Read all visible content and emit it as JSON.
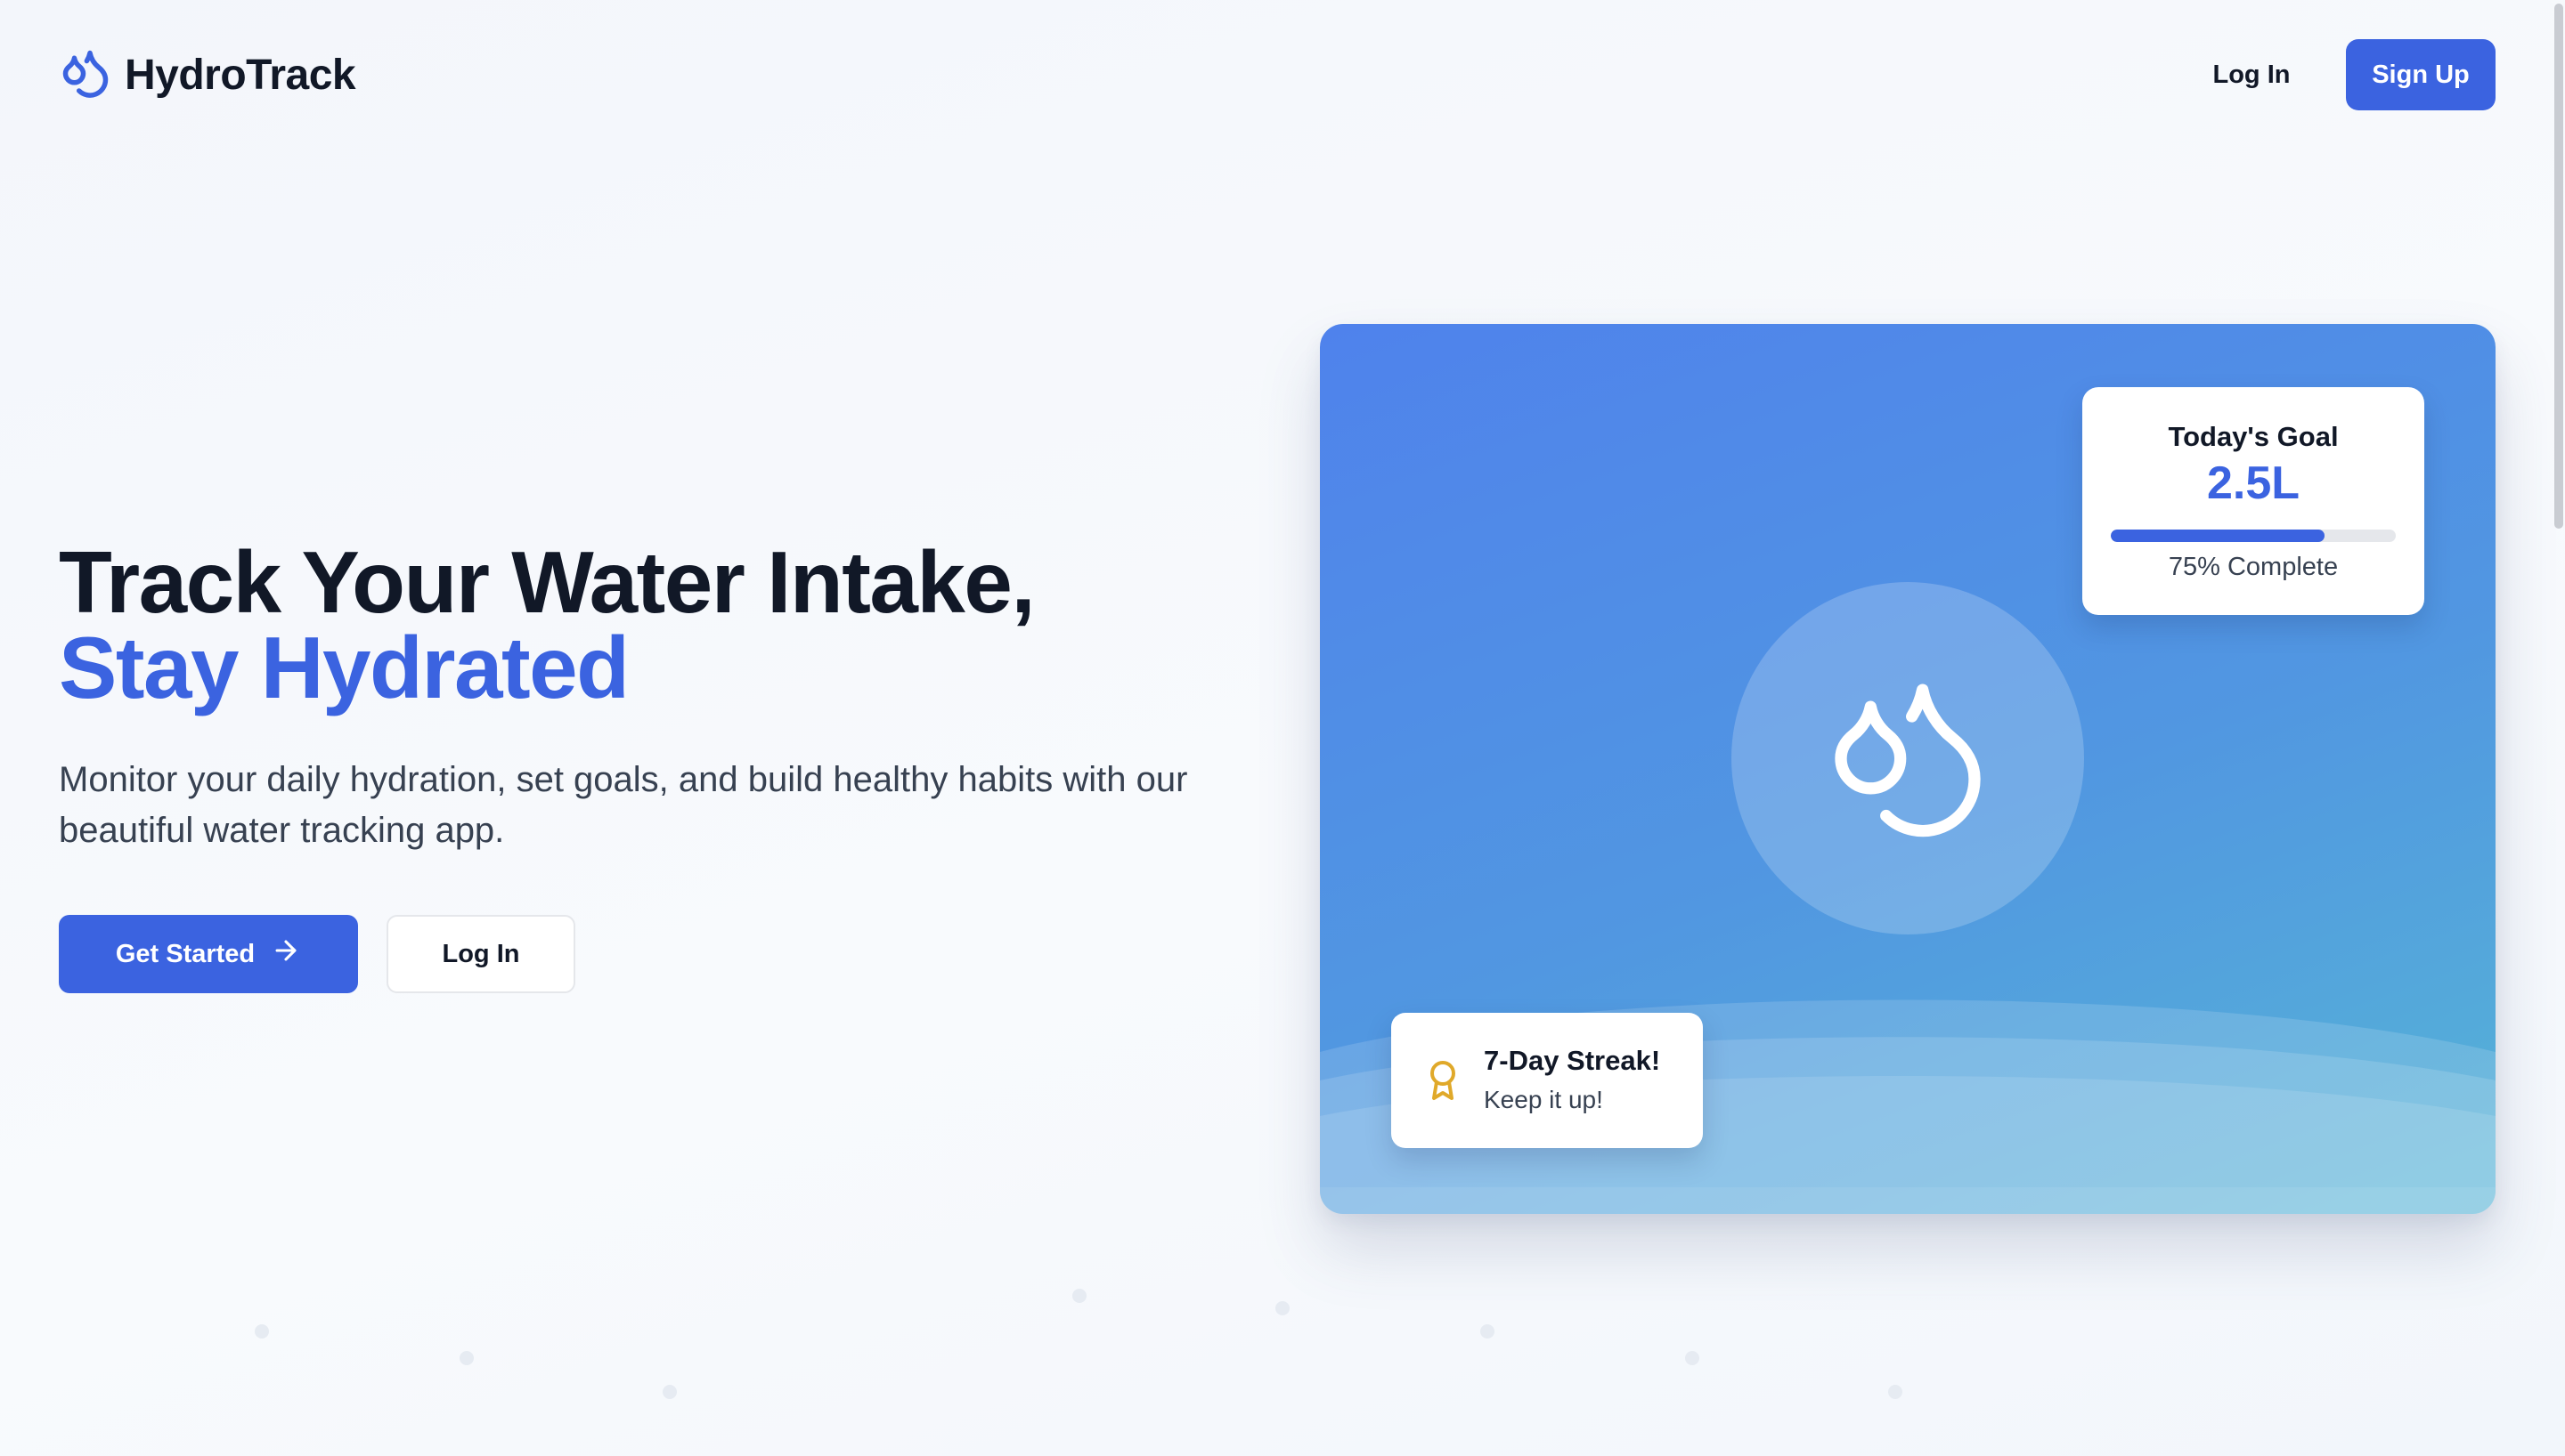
{
  "brand": {
    "name": "HydroTrack",
    "icon": "droplets-icon",
    "color": "#3b63e0"
  },
  "nav": {
    "login_label": "Log In",
    "signup_label": "Sign Up"
  },
  "hero": {
    "title_line1": "Track Your Water Intake,",
    "title_line2": "Stay Hydrated",
    "subtitle": "Monitor your daily hydration, set goals, and build healthy habits with our beautiful water tracking app.",
    "primary_cta": "Get Started",
    "primary_cta_icon": "arrow-right-icon",
    "secondary_cta": "Log In"
  },
  "preview": {
    "center_icon": "droplets-icon",
    "goal_card": {
      "title": "Today's Goal",
      "value": "2.5L",
      "progress": 0.75,
      "caption": "75% Complete"
    },
    "streak_card": {
      "icon": "award-icon",
      "title": "7-Day Streak!",
      "subtitle": "Keep it up!"
    }
  },
  "colors": {
    "accent": "#3b63e0",
    "heading": "#111827",
    "body_text": "#374151",
    "streak_icon": "#e0a92a"
  }
}
